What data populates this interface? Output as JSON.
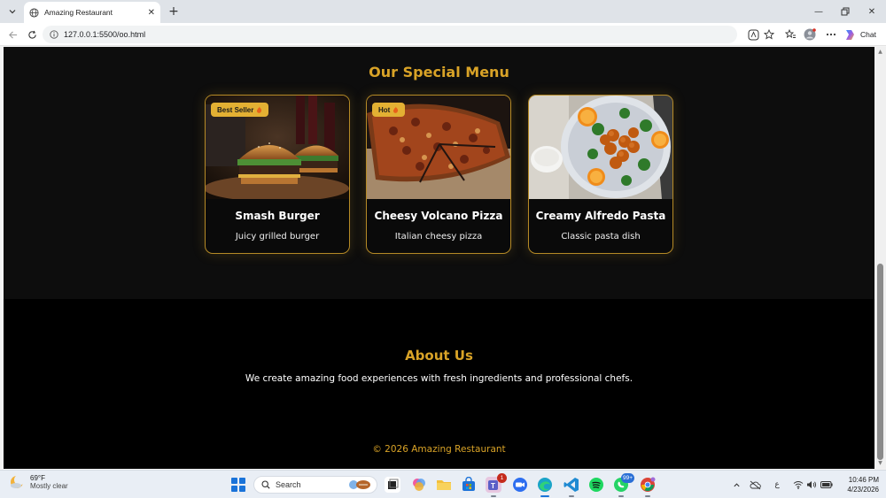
{
  "browser": {
    "tab_title": "Amazing Restaurant",
    "url": "127.0.0.1:5500/oo.html",
    "chat_label": "Chat"
  },
  "page": {
    "menu": {
      "title": "Our Special Menu",
      "items": [
        {
          "name": "Smash Burger",
          "description": "Juicy grilled burger",
          "badge": "Best Seller",
          "badge_icon": "fire-icon"
        },
        {
          "name": "Cheesy Volcano Pizza",
          "description": "Italian cheesy pizza",
          "badge": "Hot",
          "badge_icon": "fire-icon"
        },
        {
          "name": "Creamy Alfredo Pasta",
          "description": "Classic pasta dish",
          "badge": "",
          "badge_icon": ""
        }
      ]
    },
    "about": {
      "title": "About Us",
      "text": "We create amazing food experiences with fresh ingredients and professional chefs."
    },
    "footer": "© 2026 Amazing Restaurant"
  },
  "taskbar": {
    "weather_temp": "69°F",
    "weather_desc": "Mostly clear",
    "search_label": "Search",
    "teams_badge": "1",
    "whatsapp_badge": "99+",
    "clock_time": "10:46 PM",
    "clock_date": "4/23/2026",
    "tray_char": "ع"
  },
  "colors": {
    "accent_gold": "#d9a327",
    "badge_bg": "#e3b033",
    "page_bg": "#0d0d0d"
  }
}
